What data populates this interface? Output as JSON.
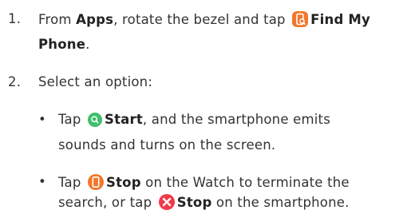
{
  "steps": [
    {
      "number": "1.",
      "line1": {
        "pre": "From ",
        "apps": "Apps",
        "mid": ", rotate the bezel and tap ",
        "find": "Find My"
      },
      "line2": {
        "phone": "Phone",
        "post": "."
      }
    },
    {
      "number": "2.",
      "text": "Select an option:",
      "bullets": [
        {
          "symbol": "•",
          "line1": {
            "pre": "Tap ",
            "bold": "Start",
            "post": ", and the smartphone emits"
          },
          "line2": "sounds and turns on the screen."
        },
        {
          "symbol": "•",
          "line1": {
            "pre": "Tap ",
            "bold": "Stop",
            "post": " on the Watch to terminate the"
          },
          "line2": {
            "pre": "search, or tap ",
            "bold": "Stop",
            "post": " on the smartphone."
          }
        }
      ]
    }
  ],
  "icons": {
    "find_my_phone": "find-my-phone-icon",
    "start": "start-search-icon",
    "stop_watch": "stop-watch-icon",
    "stop_phone": "stop-close-icon"
  },
  "colors": {
    "text": "#333333",
    "orange": "#f2772c",
    "green": "#3fbf6a",
    "red": "#f03a4c"
  }
}
